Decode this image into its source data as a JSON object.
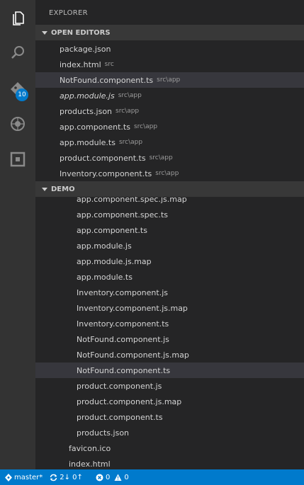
{
  "explorer": {
    "title": "EXPLORER"
  },
  "activity_bar": {
    "icons": [
      "files-icon",
      "search-icon",
      "git-icon",
      "debug-icon",
      "extensions-icon"
    ],
    "git_badge": "10"
  },
  "open_editors": {
    "header": "OPEN EDITORS",
    "items": [
      {
        "name": "package.json",
        "path": ""
      },
      {
        "name": "index.html",
        "path": "src"
      },
      {
        "name": "NotFound.component.ts",
        "path": "src\\app"
      },
      {
        "name": "app.module.js",
        "path": "src\\app"
      },
      {
        "name": "products.json",
        "path": "src\\app"
      },
      {
        "name": "app.component.ts",
        "path": "src\\app"
      },
      {
        "name": "app.module.ts",
        "path": "src\\app"
      },
      {
        "name": "product.component.ts",
        "path": "src\\app"
      },
      {
        "name": "Inventory.component.ts",
        "path": "src\\app"
      }
    ]
  },
  "demo": {
    "header": "DEMO",
    "partial_item": "app.component.spec.js.map",
    "items": [
      "app.component.spec.ts",
      "app.component.ts",
      "app.module.js",
      "app.module.js.map",
      "app.module.ts",
      "Inventory.component.js",
      "Inventory.component.js.map",
      "Inventory.component.ts",
      "NotFound.component.js",
      "NotFound.component.js.map",
      "NotFound.component.ts",
      "product.component.js",
      "product.component.js.map",
      "product.component.ts",
      "products.json"
    ],
    "root_items": [
      "favicon.ico",
      "index.html"
    ]
  },
  "status_bar": {
    "branch": "master*",
    "sync": "2↓ 0↑",
    "errors": "0",
    "warnings": "0"
  },
  "colors": {
    "activity_bar": "#333333",
    "sidebar": "#252526",
    "section_header": "#383838",
    "selected_row": "#37373d",
    "status_bar": "#007acc"
  }
}
